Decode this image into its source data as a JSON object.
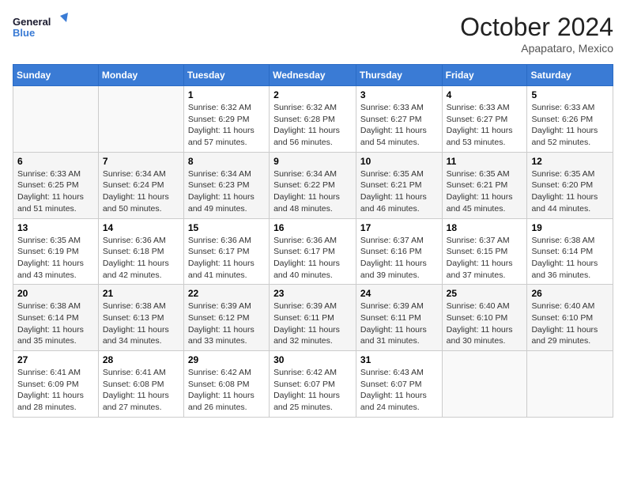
{
  "header": {
    "logo_line1": "General",
    "logo_line2": "Blue",
    "month": "October 2024",
    "location": "Apapataro, Mexico"
  },
  "weekdays": [
    "Sunday",
    "Monday",
    "Tuesday",
    "Wednesday",
    "Thursday",
    "Friday",
    "Saturday"
  ],
  "weeks": [
    [
      {
        "day": "",
        "info": ""
      },
      {
        "day": "",
        "info": ""
      },
      {
        "day": "1",
        "info": "Sunrise: 6:32 AM\nSunset: 6:29 PM\nDaylight: 11 hours and 57 minutes."
      },
      {
        "day": "2",
        "info": "Sunrise: 6:32 AM\nSunset: 6:28 PM\nDaylight: 11 hours and 56 minutes."
      },
      {
        "day": "3",
        "info": "Sunrise: 6:33 AM\nSunset: 6:27 PM\nDaylight: 11 hours and 54 minutes."
      },
      {
        "day": "4",
        "info": "Sunrise: 6:33 AM\nSunset: 6:27 PM\nDaylight: 11 hours and 53 minutes."
      },
      {
        "day": "5",
        "info": "Sunrise: 6:33 AM\nSunset: 6:26 PM\nDaylight: 11 hours and 52 minutes."
      }
    ],
    [
      {
        "day": "6",
        "info": "Sunrise: 6:33 AM\nSunset: 6:25 PM\nDaylight: 11 hours and 51 minutes."
      },
      {
        "day": "7",
        "info": "Sunrise: 6:34 AM\nSunset: 6:24 PM\nDaylight: 11 hours and 50 minutes."
      },
      {
        "day": "8",
        "info": "Sunrise: 6:34 AM\nSunset: 6:23 PM\nDaylight: 11 hours and 49 minutes."
      },
      {
        "day": "9",
        "info": "Sunrise: 6:34 AM\nSunset: 6:22 PM\nDaylight: 11 hours and 48 minutes."
      },
      {
        "day": "10",
        "info": "Sunrise: 6:35 AM\nSunset: 6:21 PM\nDaylight: 11 hours and 46 minutes."
      },
      {
        "day": "11",
        "info": "Sunrise: 6:35 AM\nSunset: 6:21 PM\nDaylight: 11 hours and 45 minutes."
      },
      {
        "day": "12",
        "info": "Sunrise: 6:35 AM\nSunset: 6:20 PM\nDaylight: 11 hours and 44 minutes."
      }
    ],
    [
      {
        "day": "13",
        "info": "Sunrise: 6:35 AM\nSunset: 6:19 PM\nDaylight: 11 hours and 43 minutes."
      },
      {
        "day": "14",
        "info": "Sunrise: 6:36 AM\nSunset: 6:18 PM\nDaylight: 11 hours and 42 minutes."
      },
      {
        "day": "15",
        "info": "Sunrise: 6:36 AM\nSunset: 6:17 PM\nDaylight: 11 hours and 41 minutes."
      },
      {
        "day": "16",
        "info": "Sunrise: 6:36 AM\nSunset: 6:17 PM\nDaylight: 11 hours and 40 minutes."
      },
      {
        "day": "17",
        "info": "Sunrise: 6:37 AM\nSunset: 6:16 PM\nDaylight: 11 hours and 39 minutes."
      },
      {
        "day": "18",
        "info": "Sunrise: 6:37 AM\nSunset: 6:15 PM\nDaylight: 11 hours and 37 minutes."
      },
      {
        "day": "19",
        "info": "Sunrise: 6:38 AM\nSunset: 6:14 PM\nDaylight: 11 hours and 36 minutes."
      }
    ],
    [
      {
        "day": "20",
        "info": "Sunrise: 6:38 AM\nSunset: 6:14 PM\nDaylight: 11 hours and 35 minutes."
      },
      {
        "day": "21",
        "info": "Sunrise: 6:38 AM\nSunset: 6:13 PM\nDaylight: 11 hours and 34 minutes."
      },
      {
        "day": "22",
        "info": "Sunrise: 6:39 AM\nSunset: 6:12 PM\nDaylight: 11 hours and 33 minutes."
      },
      {
        "day": "23",
        "info": "Sunrise: 6:39 AM\nSunset: 6:11 PM\nDaylight: 11 hours and 32 minutes."
      },
      {
        "day": "24",
        "info": "Sunrise: 6:39 AM\nSunset: 6:11 PM\nDaylight: 11 hours and 31 minutes."
      },
      {
        "day": "25",
        "info": "Sunrise: 6:40 AM\nSunset: 6:10 PM\nDaylight: 11 hours and 30 minutes."
      },
      {
        "day": "26",
        "info": "Sunrise: 6:40 AM\nSunset: 6:10 PM\nDaylight: 11 hours and 29 minutes."
      }
    ],
    [
      {
        "day": "27",
        "info": "Sunrise: 6:41 AM\nSunset: 6:09 PM\nDaylight: 11 hours and 28 minutes."
      },
      {
        "day": "28",
        "info": "Sunrise: 6:41 AM\nSunset: 6:08 PM\nDaylight: 11 hours and 27 minutes."
      },
      {
        "day": "29",
        "info": "Sunrise: 6:42 AM\nSunset: 6:08 PM\nDaylight: 11 hours and 26 minutes."
      },
      {
        "day": "30",
        "info": "Sunrise: 6:42 AM\nSunset: 6:07 PM\nDaylight: 11 hours and 25 minutes."
      },
      {
        "day": "31",
        "info": "Sunrise: 6:43 AM\nSunset: 6:07 PM\nDaylight: 11 hours and 24 minutes."
      },
      {
        "day": "",
        "info": ""
      },
      {
        "day": "",
        "info": ""
      }
    ]
  ]
}
